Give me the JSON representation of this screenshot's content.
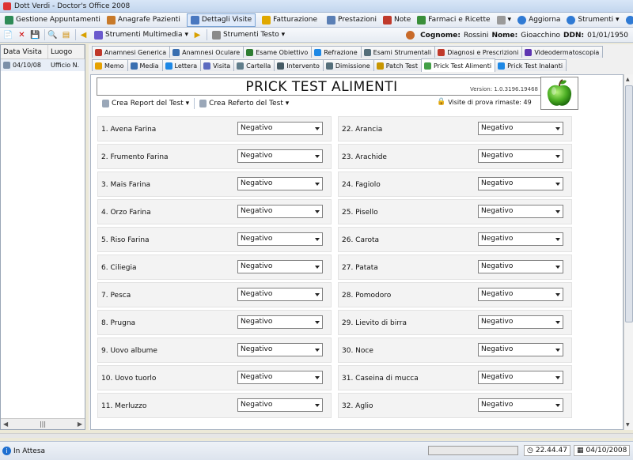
{
  "window": {
    "title": "Dott Verdi - Doctor's Office 2008"
  },
  "menu": [
    {
      "label": "Gestione Appuntamenti",
      "icon": "calendar-icon",
      "color": "#2e8b57"
    },
    {
      "label": "Anagrafe Pazienti",
      "icon": "users-icon",
      "color": "#c87a2a"
    },
    {
      "label": "Dettagli Visite",
      "icon": "details-icon",
      "color": "#4a78c0",
      "active": true
    },
    {
      "label": "Fatturazione",
      "icon": "coin-icon",
      "color": "#e0a800"
    },
    {
      "label": "Prestazioni",
      "icon": "folder-icon",
      "color": "#5a7fb5"
    },
    {
      "label": "Note",
      "icon": "note-icon",
      "color": "#c03a2b"
    },
    {
      "label": "Farmaci e Ricette",
      "icon": "pill-icon",
      "color": "#3a8f3a"
    }
  ],
  "menu_right": [
    {
      "label": "Aggiorna",
      "icon": "globe-icon"
    },
    {
      "label": "Strumenti",
      "icon": "tools-icon"
    }
  ],
  "toolbar": {
    "multimedia_label": "Strumenti Multimedia",
    "text_tools_label": "Strumenti Testo"
  },
  "patient": {
    "surname_label": "Cognome:",
    "surname": "Rossini",
    "name_label": "Nome:",
    "name": "Gioacchino",
    "ddn_label": "DDN:",
    "ddn": "01/01/1950"
  },
  "visits_list": {
    "headers": [
      "Data Visita",
      "Luogo"
    ],
    "rows": [
      {
        "date": "04/10/08",
        "place": "Ufficio N."
      }
    ]
  },
  "tabs_row1": [
    {
      "label": "Anamnesi Generica",
      "color": "#c0392b"
    },
    {
      "label": "Anamnesi Oculare",
      "color": "#3a6fb0"
    },
    {
      "label": "Esame Obiettivo",
      "color": "#2e7d32"
    },
    {
      "label": "Refrazione",
      "color": "#1e88e5"
    },
    {
      "label": "Esami Strumentali",
      "color": "#546e7a"
    },
    {
      "label": "Diagnosi e Prescrizioni",
      "color": "#c0392b"
    },
    {
      "label": "Videodermatoscopia",
      "color": "#5e35b1"
    }
  ],
  "tabs_row2": [
    {
      "label": "Memo",
      "color": "#e6a100"
    },
    {
      "label": "Media",
      "color": "#3a6fb0"
    },
    {
      "label": "Lettera",
      "color": "#1e88e5"
    },
    {
      "label": "Visita",
      "color": "#5c6bc0"
    },
    {
      "label": "Cartella",
      "color": "#607d8b"
    },
    {
      "label": "Intervento",
      "color": "#455a64"
    },
    {
      "label": "Dimissione",
      "color": "#546e7a"
    },
    {
      "label": "Patch Test",
      "color": "#c89600"
    },
    {
      "label": "Prick Test Alimenti",
      "color": "#43a047",
      "selected": true
    },
    {
      "label": "Prick Test Inalanti",
      "color": "#1e88e5"
    }
  ],
  "panel": {
    "title": "PRICK TEST ALIMENTI",
    "version": "Version: 1.0.3196.19468",
    "create_report": "Crea Report del Test",
    "create_referto": "Crea Referto del Test",
    "visits_remaining": "Visite di prova rimaste: 49"
  },
  "tests_left": [
    {
      "label": "1. Avena Farina",
      "value": "Negativo"
    },
    {
      "label": "2. Frumento Farina",
      "value": "Negativo"
    },
    {
      "label": "3. Mais Farina",
      "value": "Negativo"
    },
    {
      "label": "4. Orzo Farina",
      "value": "Negativo"
    },
    {
      "label": "5. Riso Farina",
      "value": "Negativo"
    },
    {
      "label": "6. Ciliegia",
      "value": "Negativo"
    },
    {
      "label": "7. Pesca",
      "value": "Negativo"
    },
    {
      "label": "8. Prugna",
      "value": "Negativo"
    },
    {
      "label": "9. Uovo albume",
      "value": "Negativo"
    },
    {
      "label": "10. Uovo tuorlo",
      "value": "Negativo"
    },
    {
      "label": "11. Merluzzo",
      "value": "Negativo"
    }
  ],
  "tests_right": [
    {
      "label": "22. Arancia",
      "value": "Negativo"
    },
    {
      "label": "23. Arachide",
      "value": "Negativo"
    },
    {
      "label": "24. Fagiolo",
      "value": "Negativo"
    },
    {
      "label": "25. Pisello",
      "value": "Negativo"
    },
    {
      "label": "26. Carota",
      "value": "Negativo"
    },
    {
      "label": "27. Patata",
      "value": "Negativo"
    },
    {
      "label": "28. Pomodoro",
      "value": "Negativo"
    },
    {
      "label": "29. Lievito di birra",
      "value": "Negativo"
    },
    {
      "label": "30. Noce",
      "value": "Negativo"
    },
    {
      "label": "31. Caseina di mucca",
      "value": "Negativo"
    },
    {
      "label": "32. Aglio",
      "value": "Negativo"
    }
  ],
  "status": {
    "left": "In Attesa",
    "time": "22.44.47",
    "date": "04/10/2008"
  }
}
